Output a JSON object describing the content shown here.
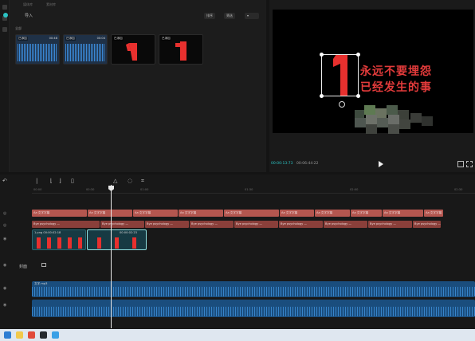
{
  "media": {
    "subtabs": [
      "媒体库",
      "素材库"
    ],
    "import_label": "导入",
    "all_label": "全部",
    "controls": [
      "排序",
      "筛选"
    ],
    "thumbs": [
      {
        "badge": "已添加",
        "duration": "00:48",
        "caption": "",
        "type": "audio"
      },
      {
        "badge": "已添加",
        "duration": "00:04",
        "caption": "",
        "type": "audio"
      },
      {
        "badge": "已添加",
        "duration": "",
        "caption": "",
        "type": "image"
      },
      {
        "badge": "已添加",
        "duration": "",
        "caption": "",
        "type": "image"
      }
    ]
  },
  "preview": {
    "text_line1": "永远不要埋怨",
    "text_line2": "已经发生的事",
    "current_time": "00:00:13:73",
    "total_time": "00:06:44:22"
  },
  "timeline": {
    "ruler_labels": [
      "00:00",
      "00:30",
      "01:00",
      "01:30",
      "02:00",
      "02:30",
      "03:00"
    ],
    "cover_label": "封面",
    "text_clips_row1": [
      {
        "label": "Aa 文字字幕",
        "width": 70
      },
      {
        "label": "Aa 文字字幕",
        "width": 57
      },
      {
        "label": "Aa 文字字幕",
        "width": 57
      },
      {
        "label": "Aa 文字字幕",
        "width": 57
      },
      {
        "label": "Aa 文字字幕",
        "width": 70
      },
      {
        "label": "Aa 文字字幕",
        "width": 44
      },
      {
        "label": "Aa 文字字幕",
        "width": 45
      },
      {
        "label": "Aa 文字字幕",
        "width": 40
      },
      {
        "label": "Aa 文字字幕",
        "width": 52
      },
      {
        "label": "Aa 文字字幕",
        "width": 25
      }
    ],
    "text_clips_row2": [
      {
        "label": "Bye psychology —",
        "width": 86
      },
      {
        "label": "Bye psychology —",
        "width": 56
      },
      {
        "label": "Bye psychology —",
        "width": 56
      },
      {
        "label": "Bye psychology —",
        "width": 56
      },
      {
        "label": "Bye psychology —",
        "width": 56
      },
      {
        "label": "Bye psychology —",
        "width": 56
      },
      {
        "label": "Bye psychology —",
        "width": 56
      },
      {
        "label": "Bye psychology —",
        "width": 56
      },
      {
        "label": "Bye psychology —",
        "width": 36
      }
    ],
    "video_clips": [
      {
        "label": "1.png 00:00:02:18"
      },
      {
        "label": "00:00:02:23"
      }
    ],
    "audio_clips": [
      {
        "label": "文字.mp3"
      },
      {
        "label": ""
      }
    ]
  }
}
